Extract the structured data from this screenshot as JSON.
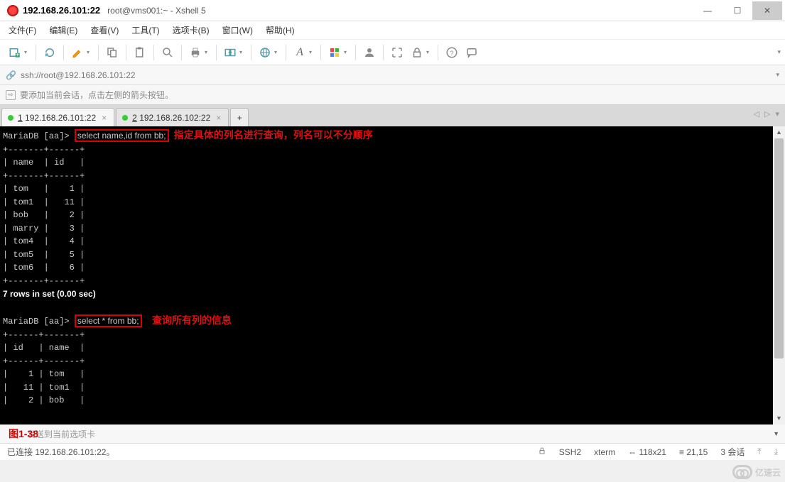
{
  "window": {
    "address": "192.168.26.101:22",
    "title_rest": "root@vms001:~ - Xshell 5"
  },
  "menu": {
    "file": "文件(F)",
    "edit": "编辑(E)",
    "view": "查看(V)",
    "tools": "工具(T)",
    "tabs": "选项卡(B)",
    "window": "窗口(W)",
    "help": "帮助(H)"
  },
  "address_bar": {
    "url": "ssh://root@192.168.26.101:22"
  },
  "hint": {
    "text": "要添加当前会话，点击左侧的箭头按钮。"
  },
  "tabs": [
    {
      "num": "1",
      "label": "192.168.26.101:22",
      "active": true
    },
    {
      "num": "2",
      "label": "192.168.26.102:22",
      "active": false
    }
  ],
  "tab_add": "+",
  "tab_nav": "◁  ▷  ▾",
  "terminal": {
    "prompt": "MariaDB [aa]>",
    "query1": "select name,id from bb;",
    "anno1": "指定具体的列名进行查询，列名可以不分顺序",
    "sep1a": "+-------+------+",
    "hdr1": "| name  | id   |",
    "sep1b": "+-------+------+",
    "rows1": [
      "| tom   |    1 |",
      "| tom1  |   11 |",
      "| bob   |    2 |",
      "| marry |    3 |",
      "| tom4  |    4 |",
      "| tom5  |    5 |",
      "| tom6  |    6 |"
    ],
    "sep1c": "+-------+------+",
    "summary1": "7 rows in set (0.00 sec)",
    "query2": "select * from bb;",
    "anno2": "查询所有列的信息",
    "sep2a": "+------+-------+",
    "hdr2": "| id   | name  |",
    "sep2b": "+------+-------+",
    "rows2": [
      "|    1 | tom   |",
      "|   11 | tom1  |",
      "|    2 | bob   |"
    ]
  },
  "sendbar": {
    "hint": "         发送到当前选项卡",
    "figure": "图1-38"
  },
  "status": {
    "connected": "已连接 192.168.26.101:22。",
    "proto": "SSH2",
    "term": "xterm",
    "size": "118x21",
    "cursor": "21,15",
    "sessions": "3 会话"
  },
  "watermark": "亿速云",
  "chart_data": {
    "type": "table",
    "tables": [
      {
        "query": "select name,id from bb;",
        "columns": [
          "name",
          "id"
        ],
        "rows": [
          [
            "tom",
            1
          ],
          [
            "tom1",
            11
          ],
          [
            "bob",
            2
          ],
          [
            "marry",
            3
          ],
          [
            "tom4",
            4
          ],
          [
            "tom5",
            5
          ],
          [
            "tom6",
            6
          ]
        ],
        "summary": "7 rows in set (0.00 sec)"
      },
      {
        "query": "select * from bb;",
        "columns": [
          "id",
          "name"
        ],
        "rows_visible": [
          [
            1,
            "tom"
          ],
          [
            11,
            "tom1"
          ],
          [
            2,
            "bob"
          ]
        ]
      }
    ]
  }
}
